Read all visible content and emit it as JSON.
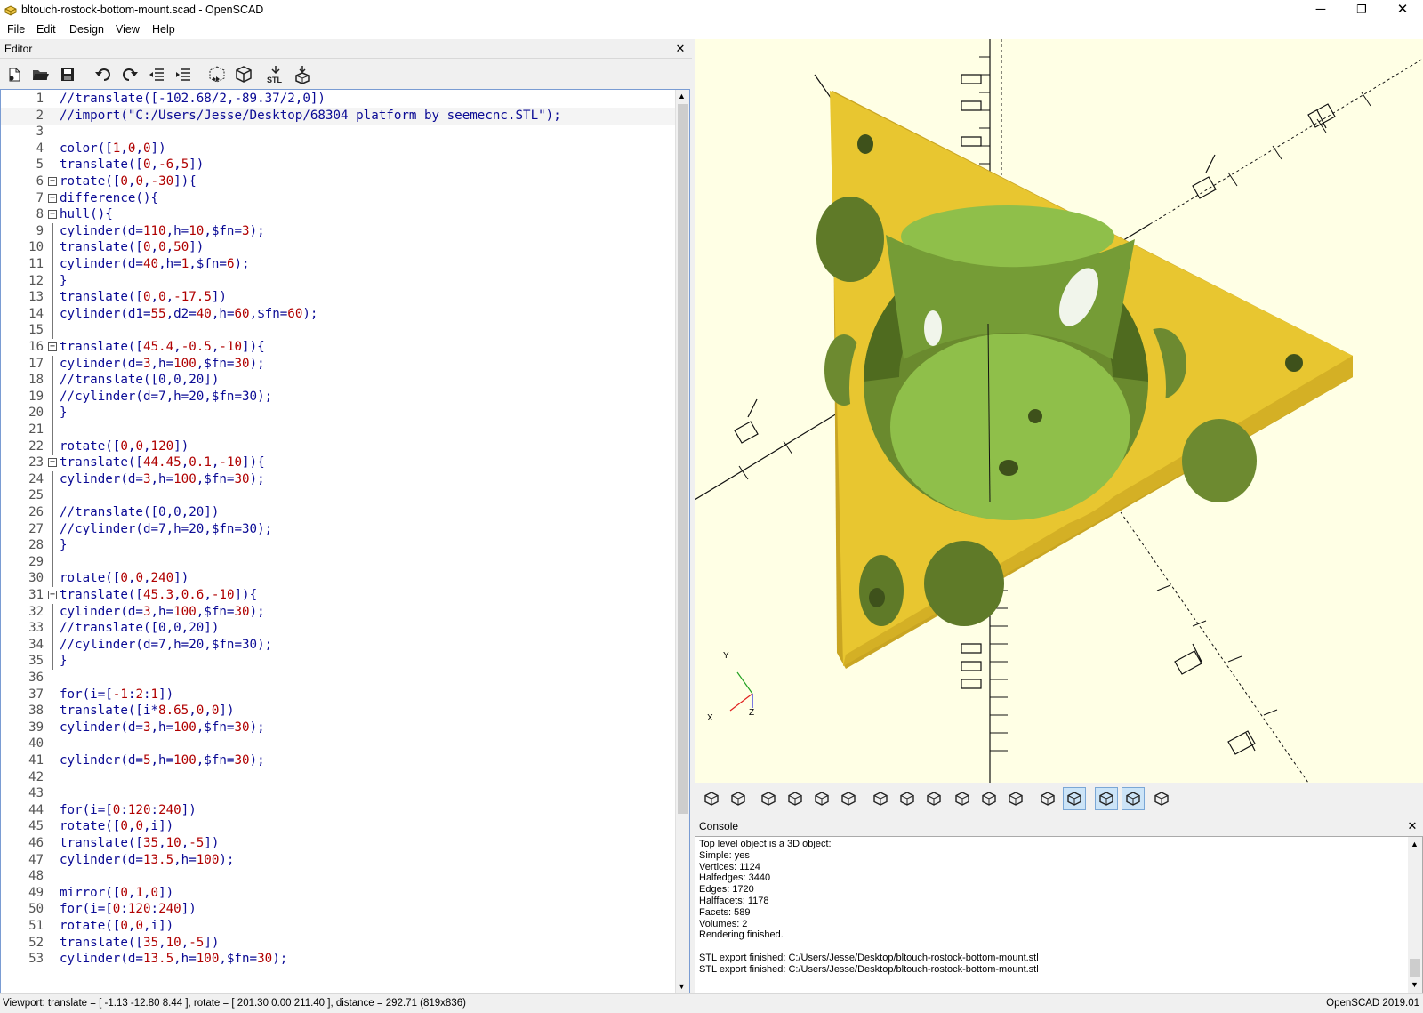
{
  "window": {
    "title": "bltouch-rostock-bottom-mount.scad - OpenSCAD",
    "minimize": "─",
    "restore": "❐",
    "close": "✕"
  },
  "menu": [
    "File",
    "Edit",
    "Design",
    "View",
    "Help"
  ],
  "editor": {
    "title": "Editor",
    "close": "✕",
    "toolbar": [
      "new-file-icon",
      "open-file-icon",
      "save-icon",
      "undo-icon",
      "redo-icon",
      "unindent-icon",
      "indent-icon",
      "preview-icon",
      "render-icon",
      "export-stl-icon",
      "send-to-print-icon"
    ],
    "lines": [
      {
        "n": "1",
        "t": "//translate([-102.68/2,-89.37/2,0])"
      },
      {
        "n": "2",
        "t": "//import(\"C:/Users/Jesse/Desktop/68304 platform by seemecnc.STL\");"
      },
      {
        "n": "3",
        "t": ""
      },
      {
        "n": "4",
        "t": "color([1,0,0])"
      },
      {
        "n": "5",
        "t": "translate([0,-6,5])"
      },
      {
        "n": "6",
        "t": "rotate([0,0,-30]){"
      },
      {
        "n": "7",
        "t": "difference(){"
      },
      {
        "n": "8",
        "t": "hull(){"
      },
      {
        "n": "9",
        "t": "cylinder(d=110,h=10,$fn=3);"
      },
      {
        "n": "10",
        "t": "translate([0,0,50])"
      },
      {
        "n": "11",
        "t": "cylinder(d=40,h=1,$fn=6);"
      },
      {
        "n": "12",
        "t": "}"
      },
      {
        "n": "13",
        "t": "translate([0,0,-17.5])"
      },
      {
        "n": "14",
        "t": "cylinder(d1=55,d2=40,h=60,$fn=60);"
      },
      {
        "n": "15",
        "t": ""
      },
      {
        "n": "16",
        "t": "translate([45.4,-0.5,-10]){"
      },
      {
        "n": "17",
        "t": "cylinder(d=3,h=100,$fn=30);"
      },
      {
        "n": "18",
        "t": "//translate([0,0,20])"
      },
      {
        "n": "19",
        "t": "//cylinder(d=7,h=20,$fn=30);"
      },
      {
        "n": "20",
        "t": "}"
      },
      {
        "n": "21",
        "t": ""
      },
      {
        "n": "22",
        "t": "rotate([0,0,120])"
      },
      {
        "n": "23",
        "t": "translate([44.45,0.1,-10]){"
      },
      {
        "n": "24",
        "t": "cylinder(d=3,h=100,$fn=30);"
      },
      {
        "n": "25",
        "t": ""
      },
      {
        "n": "26",
        "t": "//translate([0,0,20])"
      },
      {
        "n": "27",
        "t": "//cylinder(d=7,h=20,$fn=30);"
      },
      {
        "n": "28",
        "t": "}"
      },
      {
        "n": "29",
        "t": ""
      },
      {
        "n": "30",
        "t": "rotate([0,0,240])"
      },
      {
        "n": "31",
        "t": "translate([45.3,0.6,-10]){"
      },
      {
        "n": "32",
        "t": "cylinder(d=3,h=100,$fn=30);"
      },
      {
        "n": "33",
        "t": "//translate([0,0,20])"
      },
      {
        "n": "34",
        "t": "//cylinder(d=7,h=20,$fn=30);"
      },
      {
        "n": "35",
        "t": "}"
      },
      {
        "n": "36",
        "t": ""
      },
      {
        "n": "37",
        "t": "for(i=[-1:2:1])"
      },
      {
        "n": "38",
        "t": "translate([i*8.65,0,0])"
      },
      {
        "n": "39",
        "t": "cylinder(d=3,h=100,$fn=30);"
      },
      {
        "n": "40",
        "t": ""
      },
      {
        "n": "41",
        "t": "cylinder(d=5,h=100,$fn=30);"
      },
      {
        "n": "42",
        "t": ""
      },
      {
        "n": "43",
        "t": ""
      },
      {
        "n": "44",
        "t": "for(i=[0:120:240])"
      },
      {
        "n": "45",
        "t": "rotate([0,0,i])"
      },
      {
        "n": "46",
        "t": "translate([35,10,-5])"
      },
      {
        "n": "47",
        "t": "cylinder(d=13.5,h=100);"
      },
      {
        "n": "48",
        "t": ""
      },
      {
        "n": "49",
        "t": "mirror([0,1,0])"
      },
      {
        "n": "50",
        "t": "for(i=[0:120:240])"
      },
      {
        "n": "51",
        "t": "rotate([0,0,i])"
      },
      {
        "n": "52",
        "t": "translate([35,10,-5])"
      },
      {
        "n": "53",
        "t": "cylinder(d=13.5,h=100,$fn=30);"
      }
    ]
  },
  "viewer": {
    "axis_labels": {
      "x": "X",
      "y": "Y",
      "z": "Z"
    },
    "toolbar": [
      "preview-icon",
      "render-icon",
      "view-all-icon",
      "zoom-in-icon",
      "zoom-out-icon",
      "reset-view-icon",
      "view-right-icon",
      "view-top-icon",
      "view-bottom-icon",
      "view-left-icon",
      "view-front-icon",
      "view-back-icon",
      "perspective-icon",
      "orthogonal-icon",
      "show-axes-icon",
      "show-scale-markers-icon",
      "show-edges-icon"
    ]
  },
  "console": {
    "title": "Console",
    "close": "✕",
    "lines": [
      "Top level object is a 3D object:",
      "Simple: yes",
      "Vertices: 1124",
      "Halfedges: 3440",
      "Edges: 1720",
      "Halffacets: 1178",
      "Facets: 589",
      "Volumes: 2",
      "Rendering finished.",
      "",
      "STL export finished: C:/Users/Jesse/Desktop/bltouch-rostock-bottom-mount.stl",
      "STL export finished: C:/Users/Jesse/Desktop/bltouch-rostock-bottom-mount.stl"
    ]
  },
  "status": {
    "viewport": "Viewport: translate = [ -1.13 -12.80 8.44 ], rotate = [ 201.30 0.00 211.40 ], distance = 292.71 (819x836)",
    "version": "OpenSCAD 2019.01"
  },
  "colors": {
    "model_top": "#e8c630",
    "model_side": "#c9a522",
    "cut_surface": "#8fbf4a",
    "viewer_background": "#ffffe5"
  }
}
